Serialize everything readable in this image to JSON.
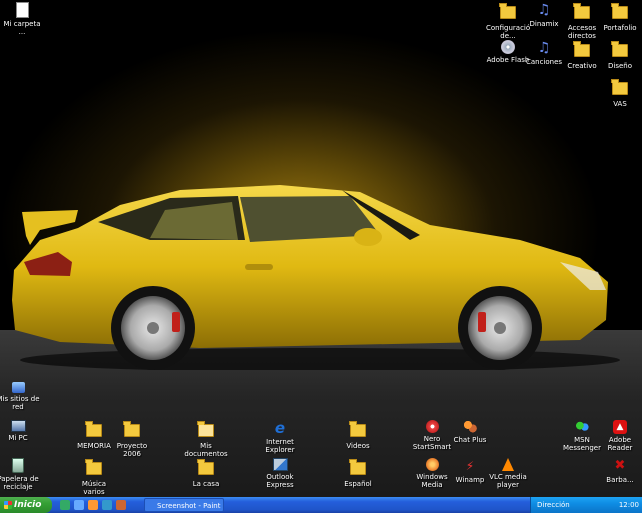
{
  "desktop": {
    "icons": [
      {
        "id": "top-left",
        "label": "Mi carpeta ...",
        "kind": "doc"
      },
      {
        "id": "tr1",
        "label": "Configuración\nde...",
        "kind": "folder"
      },
      {
        "id": "tr2",
        "label": "Dinamix",
        "kind": "music"
      },
      {
        "id": "tr3",
        "label": "Accesos\ndirectos de...",
        "kind": "folder"
      },
      {
        "id": "tr4",
        "label": "Portafolio",
        "kind": "folder"
      },
      {
        "id": "tr5",
        "label": "Adobe Flash",
        "kind": "disc"
      },
      {
        "id": "tr6",
        "label": "Canciones",
        "kind": "music"
      },
      {
        "id": "tr7",
        "label": "Creativo",
        "kind": "folder"
      },
      {
        "id": "tr8",
        "label": "Diseño",
        "kind": "folder"
      },
      {
        "id": "tr9",
        "label": "VAS",
        "kind": "folder"
      },
      {
        "id": "b1",
        "label": "Mis sitios de\nred",
        "kind": "net"
      },
      {
        "id": "b2",
        "label": "Mi PC",
        "kind": "pc"
      },
      {
        "id": "b3",
        "label": "MEMORIA",
        "kind": "folder"
      },
      {
        "id": "b4",
        "label": "Proyecto\n2006",
        "kind": "folder"
      },
      {
        "id": "b5",
        "label": "Mis\ndocumentos",
        "kind": "docs"
      },
      {
        "id": "b6",
        "label": "Internet\nExplorer",
        "kind": "ie"
      },
      {
        "id": "b7",
        "label": "Videos",
        "kind": "folder"
      },
      {
        "id": "b8",
        "label": "Nero\nStartSmart",
        "kind": "nero"
      },
      {
        "id": "b9",
        "label": "Chat Plus",
        "kind": "chat"
      },
      {
        "id": "b10",
        "label": "MSN\nMessenger",
        "kind": "msn"
      },
      {
        "id": "b11",
        "label": "Adobe Reader",
        "kind": "reader"
      },
      {
        "id": "c1",
        "label": "Papelera de\nreciclaje",
        "kind": "bin"
      },
      {
        "id": "c2",
        "label": "Música\nvarios",
        "kind": "folder"
      },
      {
        "id": "c3",
        "label": "La casa",
        "kind": "folder"
      },
      {
        "id": "c4",
        "label": "Outlook\nExpress",
        "kind": "outlook"
      },
      {
        "id": "c5",
        "label": "Español",
        "kind": "folder"
      },
      {
        "id": "c6",
        "label": "Windows\nMedia",
        "kind": "wmp"
      },
      {
        "id": "c7",
        "label": "Winamp",
        "kind": "winamp"
      },
      {
        "id": "c8",
        "label": "VLC media\nplayer",
        "kind": "vlc"
      },
      {
        "id": "c9",
        "label": "Barba...",
        "kind": "kill"
      }
    ]
  },
  "taskbar": {
    "start_label": "Inicio",
    "task_label": "Screenshot - Paint",
    "tray_label": "Dirección",
    "clock": "12:00"
  }
}
